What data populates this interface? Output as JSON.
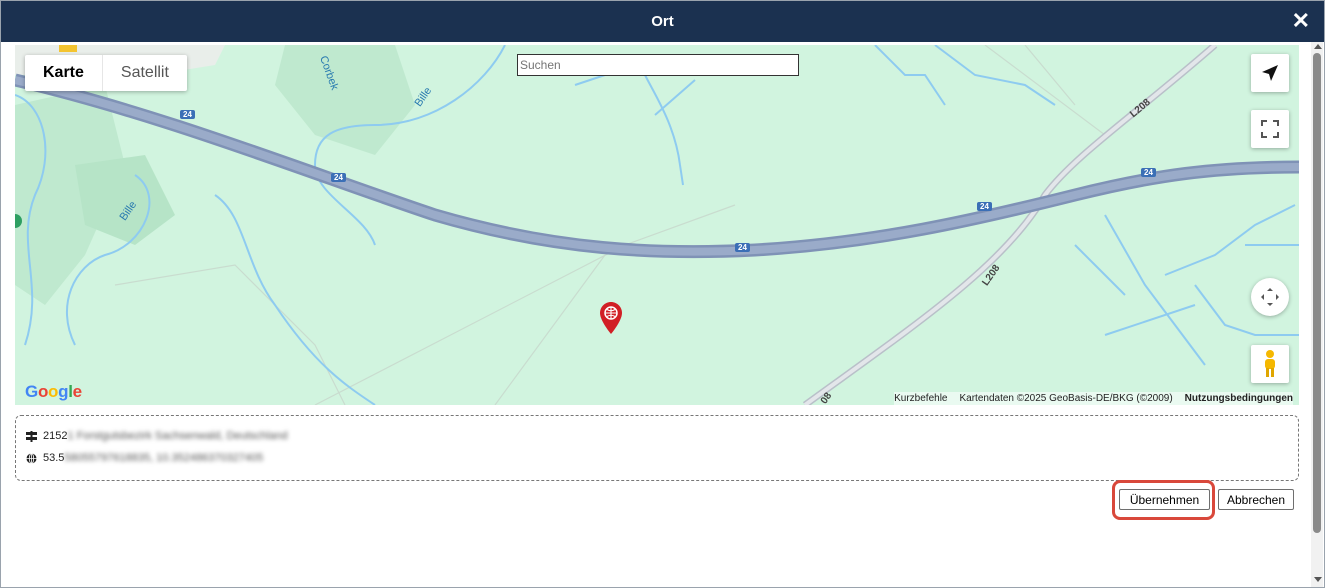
{
  "dialog": {
    "title": "Ort",
    "close_glyph": "✕"
  },
  "map": {
    "map_type": {
      "map_label": "Karte",
      "satellite_label": "Satellit",
      "selected": "Karte"
    },
    "search": {
      "placeholder": "Suchen",
      "value": ""
    },
    "road_labels": {
      "a24_1": "24",
      "a24_2": "24",
      "a24_3": "24",
      "a24_4": "24",
      "a24_5": "24",
      "l208_1": "L208",
      "l208_2": "L208",
      "l208_3": "08"
    },
    "water_labels": {
      "corbek": "Corbek",
      "bille_1": "Bille",
      "bille_2": "Bille"
    },
    "google_logo": "Google",
    "attribution": {
      "shortcuts": "Kurzbefehle",
      "map_data": "Kartendaten ©2025 GeoBasis-DE/BKG (©2009)",
      "terms": "Nutzungsbedingungen"
    },
    "controls": [
      "navigation-arrow-icon",
      "fullscreen-icon",
      "camera-control-icon",
      "pegman-icon"
    ],
    "marker": "red-globe-pin-icon",
    "colors": {
      "land": "#d1f4df",
      "highway": "#8a9bbd",
      "water": "#8ecbf0",
      "marker": "#d11f25"
    }
  },
  "location": {
    "address_prefix": "2152",
    "address_blurred": "1 Forstgutsbezirk Sachsenwald, Deutschland",
    "coords_prefix": "53.5",
    "coords_blurred": "58055797618835, 10.352486370327405"
  },
  "buttons": {
    "apply": "Übernehmen",
    "cancel": "Abbrechen"
  },
  "colors": {
    "titlebar": "#1b3150",
    "highlight": "#d9483b"
  }
}
